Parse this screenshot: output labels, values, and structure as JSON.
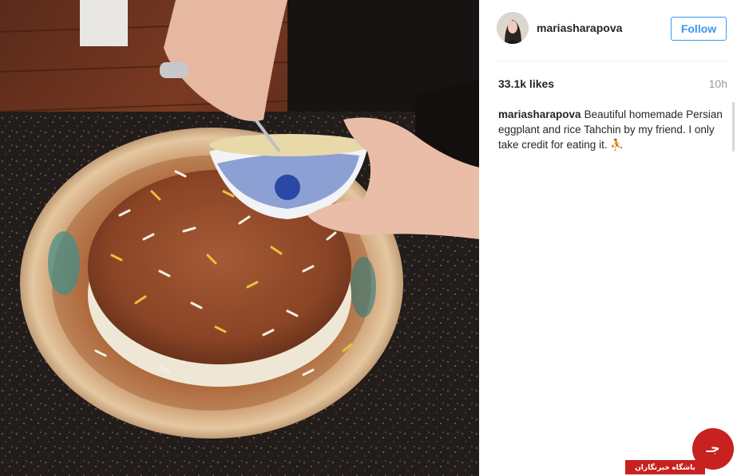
{
  "post": {
    "username": "mariasharapova",
    "follow_label": "Follow",
    "likes": "33.1k likes",
    "time_ago": "10h",
    "caption_user": "mariasharapova",
    "caption_text": "Beautiful homemade Persian eggplant and rice Tahchin by my friend. I only take credit for eating it. ⛹"
  },
  "watermark": {
    "bar_text": "باشگاه خبرنگاران",
    "logo_text": "جـ"
  },
  "colors": {
    "accent": "#3897f0",
    "text": "#262626",
    "muted": "#999999",
    "watermark_red": "#c7221f"
  }
}
